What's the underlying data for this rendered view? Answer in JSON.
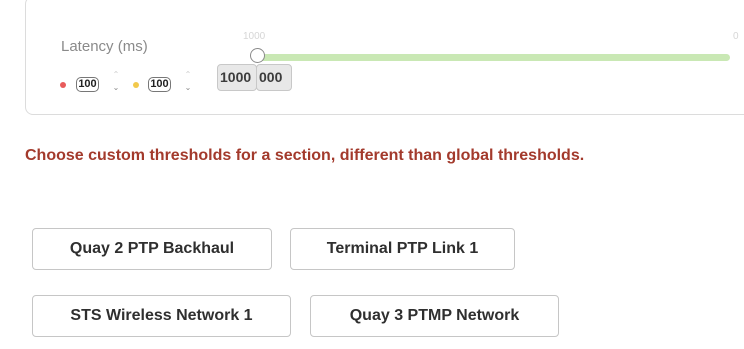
{
  "latency": {
    "label": "Latency (ms)",
    "red_value": "100",
    "yellow_value": "100",
    "spinner_up": "⌃",
    "spinner_down": "⌄",
    "slider_max_label": "1000",
    "slider_min_label": "0",
    "slider_level": 1.0,
    "value_box_1": "1000",
    "value_box_2": "000",
    "colors": {
      "red": "#e85b5b",
      "yellow": "#f2c94c",
      "track": "#c9e8b4"
    }
  },
  "notice": "Choose custom thresholds for a section, different than global thresholds.",
  "sections": [
    "Quay 2 PTP Backhaul",
    "Terminal PTP Link 1",
    "STS Wireless Network 1",
    "Quay 3 PTMP Network"
  ]
}
